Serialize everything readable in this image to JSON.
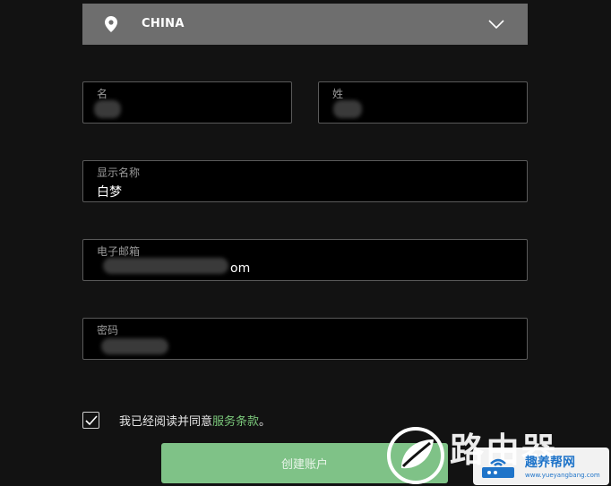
{
  "country": {
    "value": "CHINA"
  },
  "form": {
    "first_name": {
      "label": "名",
      "value": ""
    },
    "last_name": {
      "label": "姓",
      "value": ""
    },
    "display_name": {
      "label": "显示名称",
      "value": "白梦"
    },
    "email": {
      "label": "电子邮箱",
      "value_suffix": "om"
    },
    "password": {
      "label": "密码",
      "value": ""
    }
  },
  "terms": {
    "checked": true,
    "text": "我已经阅读并同意",
    "link": "服务条款",
    "end": "。"
  },
  "create_button": {
    "label": "创建账户"
  },
  "watermark": {
    "text": "路由器",
    "badge_title": "趣养帮网",
    "badge_url": "www.yueyangbang.com"
  },
  "colors": {
    "background": "#121212",
    "dropdown": "#6e6e6e",
    "accent": "#7fc287",
    "link": "#7ac77a"
  }
}
